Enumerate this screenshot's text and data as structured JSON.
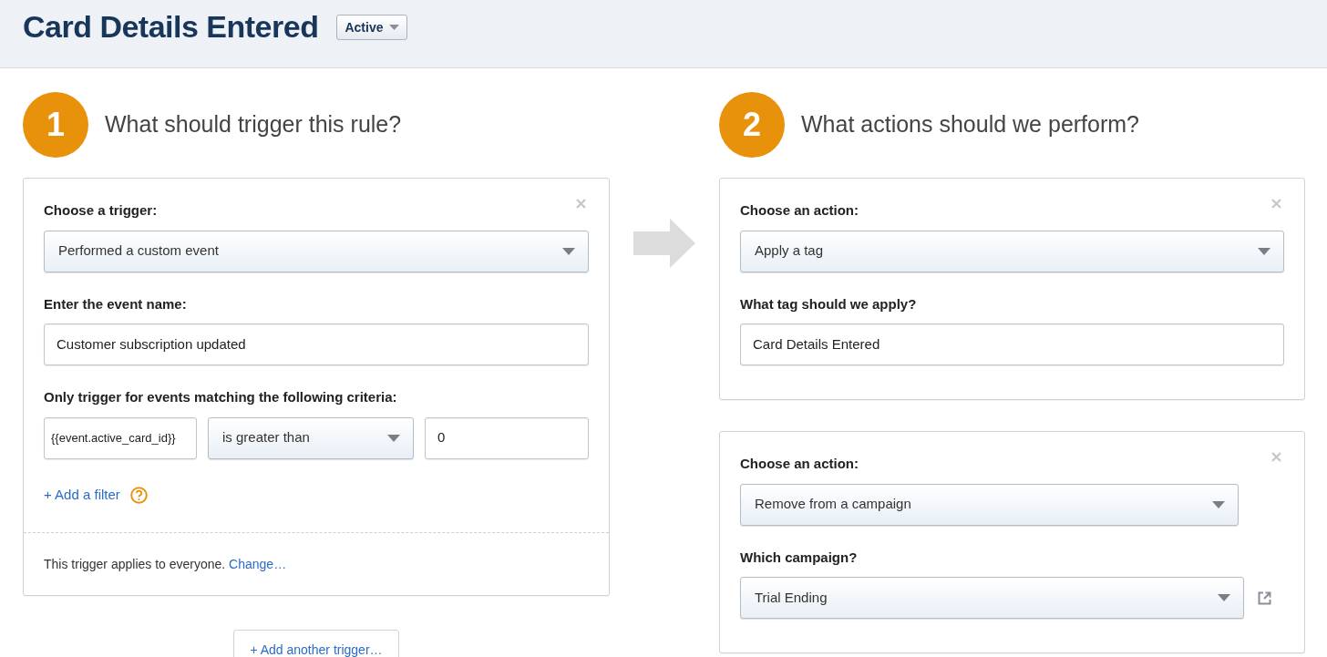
{
  "header": {
    "title": "Card Details Entered",
    "status": {
      "label": "Active"
    }
  },
  "trigger_section": {
    "number": "1",
    "question": "What should trigger this rule?",
    "card": {
      "fields": [
        {
          "kind": "select",
          "label": "Choose a trigger:",
          "value": "Performed a custom event"
        },
        {
          "kind": "input",
          "label": "Enter the event name:",
          "value": "Customer subscription updated"
        },
        {
          "kind": "criteria",
          "label": "Only trigger for events matching the following criteria:",
          "items": [
            {
              "kind": "input",
              "value": "{{event.active_card_id}}"
            },
            {
              "kind": "select",
              "value": "is greater than"
            },
            {
              "kind": "input",
              "value": "0"
            }
          ]
        }
      ],
      "add_filter": "+ Add a filter",
      "footer": {
        "text": "This trigger applies to everyone.",
        "link": "Change…"
      }
    },
    "add_button": "+ Add another trigger…"
  },
  "action_section": {
    "number": "2",
    "question": "What actions should we perform?",
    "cards": [
      {
        "fields": [
          {
            "kind": "select",
            "label": "Choose an action:",
            "value": "Apply a tag"
          },
          {
            "kind": "input",
            "label": "What tag should we apply?",
            "value": "Card Details Entered"
          }
        ]
      },
      {
        "fields": [
          {
            "kind": "select",
            "label": "Choose an action:",
            "value": "Remove from a campaign"
          },
          {
            "kind": "select",
            "label": "Which campaign?",
            "value": "Trial Ending",
            "external_link": true
          }
        ]
      }
    ]
  }
}
